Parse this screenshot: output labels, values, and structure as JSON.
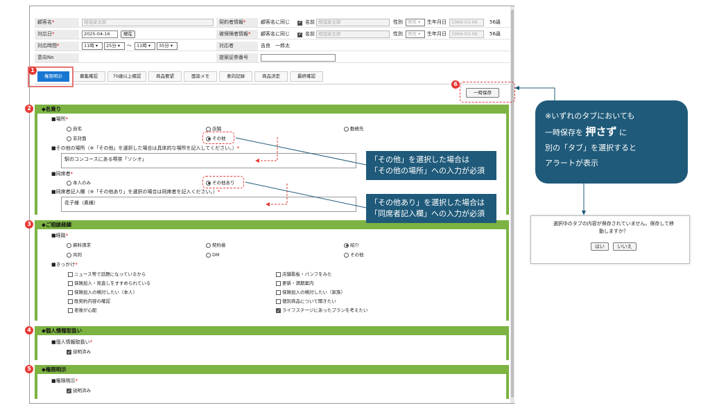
{
  "header": {
    "customer_name_label": "顧客名",
    "customer_name_value": "相塩家太郎",
    "contract_label": "契約者情報",
    "contract_same": "顧客名に同じ",
    "name_label": "名前",
    "contract_name_value": "相塩家太郎",
    "gender_label": "性別",
    "gender_value": "男性",
    "birth_label": "生年月日",
    "birth_value": "1969-03-06",
    "age": "56歳",
    "date_label": "対応日",
    "date_value": "2025-04-16",
    "now_button": "現在",
    "insured_label": "被保険者情報",
    "insured_same": "顧客名に同じ",
    "insured_name_value": "相塩家太郎",
    "time_label": "対応時間",
    "time_h1": "11時",
    "time_m1": "25分",
    "time_sep": "〜",
    "time_h2": "11時",
    "time_m2": "35分",
    "staff_label": "対応者",
    "staff_value": "吉良　一郎太",
    "intent_label": "意向No",
    "proposal_label": "提案証券番号"
  },
  "tabs": [
    "権限明示",
    "募集確認",
    "70歳以上確認",
    "商品要望",
    "面談メモ",
    "意向記録",
    "商品決定",
    "最終確認"
  ],
  "save_button": "一時保存",
  "sections": {
    "s1": {
      "title": "名乗り",
      "place_label": "場所",
      "place_options": [
        "自宅",
        "店舗",
        "勤務先",
        "非対面",
        "その他"
      ],
      "other_place_label": "その他の場所（※「その他」を選択した場合は具体的な場所を記入してください。）",
      "other_place_value": "駅のコンコースにある喫茶「ソシオ」",
      "companion_label": "同席者",
      "companion_options": [
        "本人のみ",
        "その他あり"
      ],
      "companion_note_label": "同席者記入欄（※「その他あり」を選択の場合は同席者を記入ください。）",
      "companion_note_value": "花子様（奥様）"
    },
    "s2": {
      "title": "ご相談経緯",
      "route_label": "経路",
      "route_options": [
        "資料請求",
        "契約者",
        "紹介",
        "共同",
        "DM",
        "その他"
      ],
      "trigger_label": "きっかけ",
      "triggers_left": [
        "ニュース等で話題になっているから",
        "保険加入・見直しをすすめられている",
        "保険加入の検討したい（本人）",
        "既契約内容の確認",
        "老後が心配"
      ],
      "triggers_right": [
        "店舗看板・パンフをみた",
        "更新・満期案内",
        "保険加入の検討したい（家族）",
        "個別商品について聞きたい",
        "ライフステージにあったプランを考えたい"
      ]
    },
    "s3": {
      "title": "個人情報取扱い",
      "item_label": "個人情報取扱い",
      "check_label": "説明済み"
    },
    "s4": {
      "title": "権限明示",
      "item_label": "権限明示",
      "check_label": "説明済み"
    }
  },
  "annotations": {
    "num1": "1",
    "num2": "2",
    "num3": "3",
    "num4": "4",
    "num5": "5",
    "num6": "6",
    "callout1_line1": "「その他」を選択した場合は",
    "callout1_line2": "「その他の場所」への入力が必須",
    "callout2_line1": "「その他あり」を選択した場合は",
    "callout2_line2": "「同席者記入欄」への入力が必須",
    "big_line1": "※いずれのタブにおいても",
    "big_line2a": "一時保存を",
    "big_line2b": "押さず",
    "big_line2c": "に",
    "big_line3": "別の「タブ」を選択すると",
    "big_line4": "アラートが表示"
  },
  "dialog": {
    "message_line1": "選択中のタブの内容が保存されていません。保存して移",
    "message_line2": "動しますか？",
    "yes": "はい",
    "no": "いいえ"
  },
  "colors": {
    "accent": "#1976d2",
    "section": "#7cb342",
    "callout": "#1f5a7a",
    "marker": "#e53935"
  }
}
